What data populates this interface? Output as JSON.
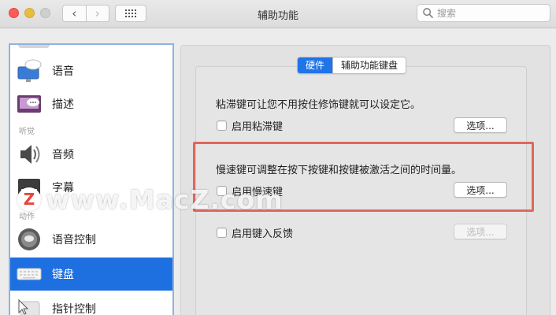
{
  "window": {
    "title": "辅助功能",
    "search_placeholder": "搜索"
  },
  "colors": {
    "accent": "#1e6fe0",
    "highlight": "#e0675e"
  },
  "sidebar": {
    "items": [
      {
        "label": "语音",
        "icon": "speech-bubble-monitor-icon"
      },
      {
        "label": "描述",
        "icon": "description-icon"
      },
      {
        "label": "音频",
        "icon": "speaker-icon"
      },
      {
        "label": "字幕",
        "icon": "captions-icon"
      },
      {
        "label": "语音控制",
        "icon": "voice-control-icon"
      },
      {
        "label": "键盘",
        "icon": "keyboard-icon",
        "selected": true
      },
      {
        "label": "指针控制",
        "icon": "pointer-control-icon"
      }
    ],
    "groups": [
      "听觉",
      "动作"
    ]
  },
  "tabs": [
    {
      "label": "硬件",
      "active": true
    },
    {
      "label": "辅助功能键盘",
      "active": false
    }
  ],
  "sticky": {
    "description": "粘滞键可让您不用按住修饰键就可以设定它。",
    "checkbox": "启用粘滞键",
    "button": "选项..."
  },
  "slow": {
    "description": "慢速键可调整在按下按键和按键被激活之间的时间量。",
    "checkbox": "启用慢速键",
    "button": "选项..."
  },
  "feedback": {
    "checkbox": "启用键入反馈",
    "button": "选项..."
  },
  "watermark": {
    "logo": "Z",
    "text": "www.MacZ.com"
  }
}
